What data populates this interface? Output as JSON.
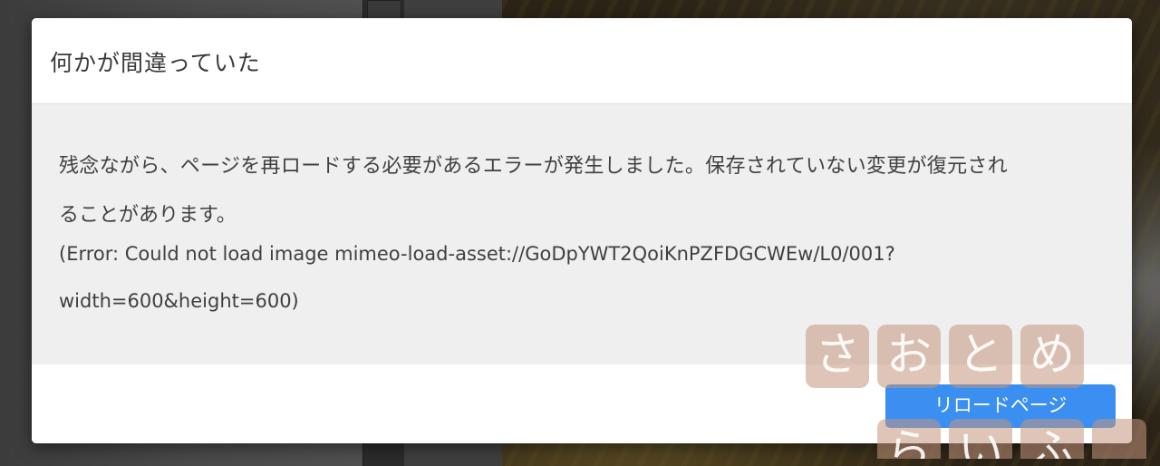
{
  "dialog": {
    "title": "何かが間違っていた",
    "message_line_1": "残念ながら、ページを再ロードする必要があるエラーが発生しました。保存されていない変更が復元され",
    "message_line_2": "ることがあります。",
    "error_line_1": "(Error: Could not load image mimeo-load-asset://GoDpYWT2QoiKnPZFDGCWEw/L0/001?",
    "error_line_2": "width=600&height=600)",
    "reload_button": "リロードページ"
  },
  "watermark": {
    "row1": [
      "さ",
      "お",
      "と",
      "め"
    ],
    "row2": [
      "ら",
      "い",
      "ふ",
      ""
    ]
  },
  "colors": {
    "button": "#3a8ff0",
    "dialog_body": "#efeff0",
    "watermark": "#c4967d"
  }
}
